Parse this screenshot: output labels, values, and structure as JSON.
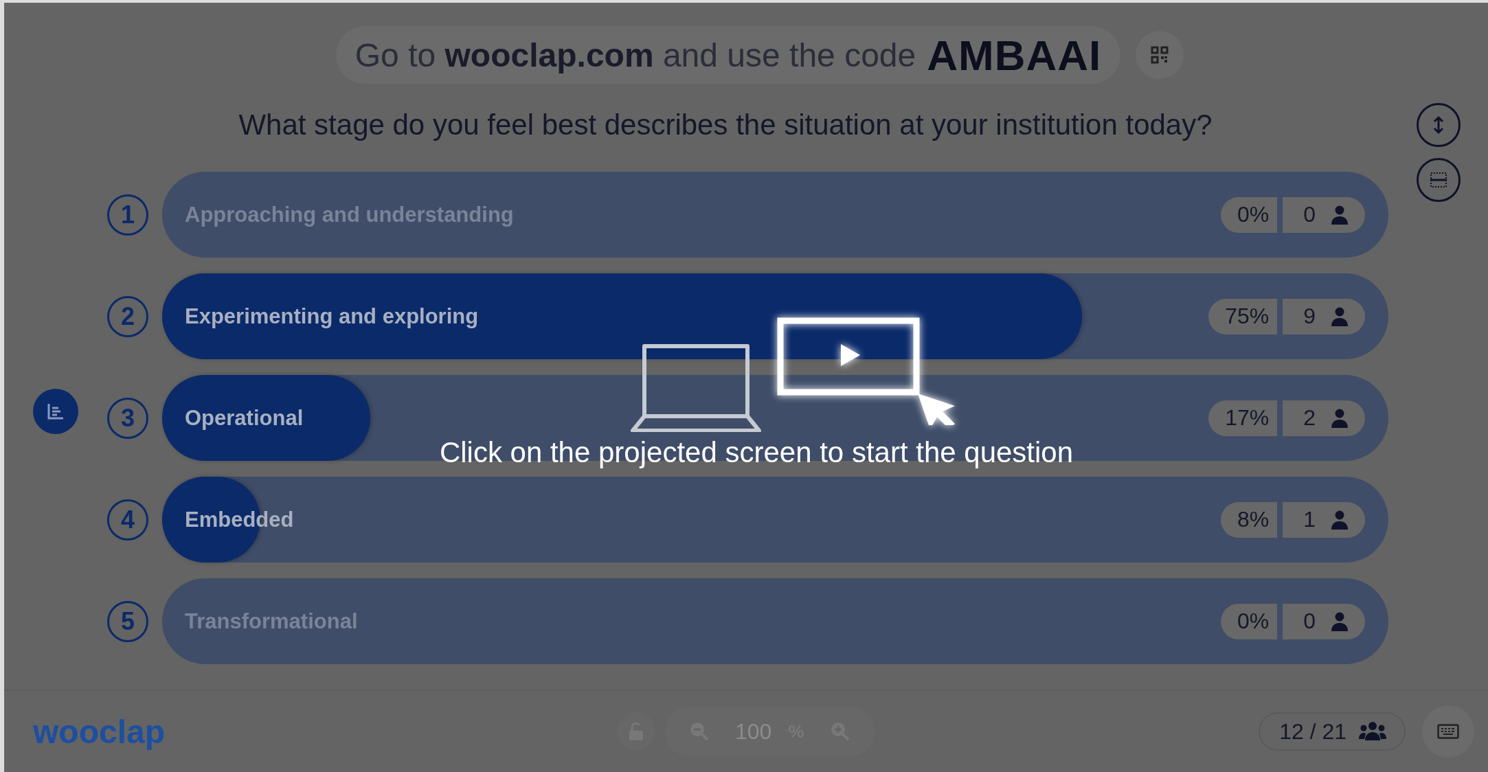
{
  "banner": {
    "text": "Go to **wooclap.com** and use the code",
    "code": "AMBAAI"
  },
  "question": "What stage do you feel best describes the situation at your institution today?",
  "answers": [
    {
      "number": "1",
      "label": "Approaching and understanding",
      "percent": "0%",
      "count": "0"
    },
    {
      "number": "2",
      "label": "Experimenting and exploring",
      "level": 0.75,
      "percent": "75%",
      "count": "9"
    },
    {
      "number": "3",
      "label": "Operational",
      "level": 0.17,
      "percent": "17%",
      "count": "2"
    },
    {
      "number": "4",
      "label": "Embedded",
      "level": 0.08,
      "percent": "8%",
      "count": "1"
    },
    {
      "number": "5",
      "label": "Transformational",
      "percent": "0%",
      "count": "0"
    }
  ],
  "overlay": {
    "message": "Click on the projected screen to start the question"
  },
  "footer": {
    "logo": "wooclap",
    "zoom_value": "100",
    "zoom_unit": "%",
    "participants": "12 / 21"
  }
}
